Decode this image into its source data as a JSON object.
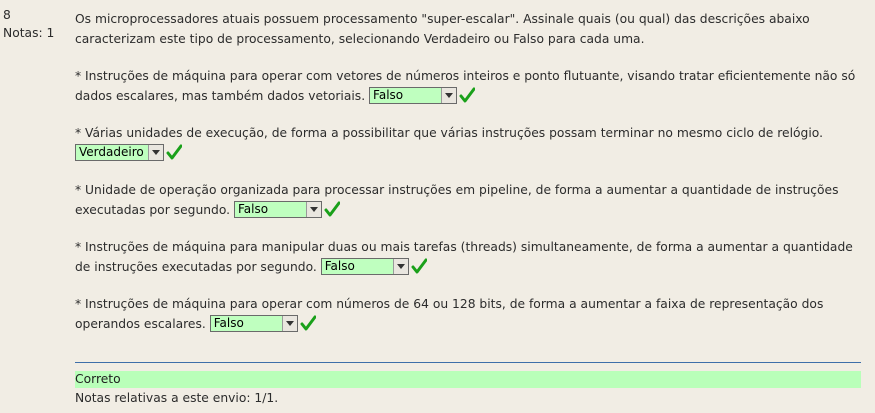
{
  "question": {
    "number": "8",
    "marks_label": "Notas: 1",
    "text": "Os microprocessadores atuais possuem processamento \"super-escalar\". Assinale quais (ou qual) das descrições abaixo caracterizam este tipo de processamento, selecionando Verdadeiro ou Falso para cada uma."
  },
  "statements": [
    {
      "text": "* Instruções de máquina para operar com vetores de números inteiros e ponto flutuante, visando tratar eficientemente não só dados escalares, mas também dados vetoriais.",
      "answer": "Falso"
    },
    {
      "text": "* Várias unidades de execução, de forma a possibilitar que várias instruções possam terminar no mesmo ciclo de relógio.",
      "answer": "Verdadeiro"
    },
    {
      "text": "* Unidade de operação organizada para processar instruções em pipeline, de forma a aumentar a quantidade de instruções executadas por segundo.",
      "answer": "Falso"
    },
    {
      "text": "* Instruções de máquina para manipular duas ou mais tarefas (threads) simultaneamente, de forma a aumentar a quantidade de instruções executadas por segundo.",
      "answer": "Falso"
    },
    {
      "text": "* Instruções de máquina para operar com números de 64 ou 128 bits, de forma a aumentar a faixa de representação dos operandos escalares.",
      "answer": "Falso"
    }
  ],
  "feedback": {
    "status": "Correto",
    "grade_text": "Notas relativas a este envio: 1/1."
  },
  "colors": {
    "select_bg": "#bfffbf",
    "correct_bg": "#b9ffb9",
    "check": "#1aa01a",
    "separator": "#3e6fa9"
  }
}
